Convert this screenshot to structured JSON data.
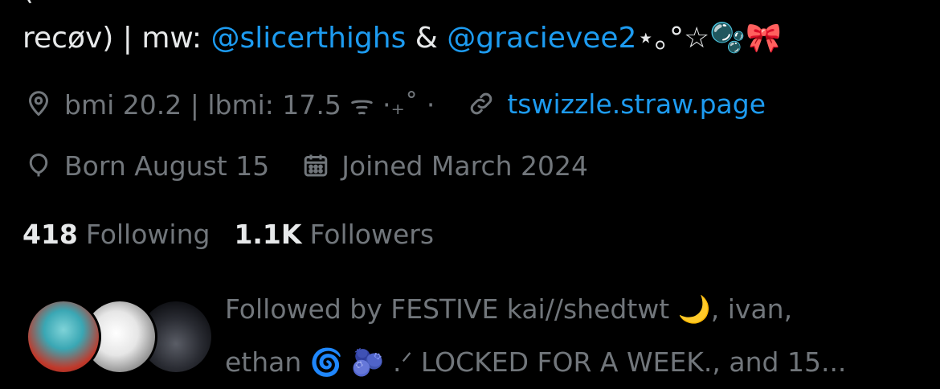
{
  "bio": {
    "top_partial": "                                                                                       (",
    "line_prefix": "recøv) | mw: ",
    "mention1": "@slicerthighs",
    "amp": " & ",
    "mention2": "@gracievee2",
    "line_suffix": "⋆｡°☆🫧🎀"
  },
  "meta": {
    "location": "bmi 20.2 | lbmi: 17.5 ᯤ ·₊˚ ·",
    "website": "tswizzle.straw.page",
    "birthday": "Born August 15",
    "joined": "Joined March 2024"
  },
  "stats": {
    "following_count": "418",
    "following_label": "Following",
    "followers_count": "1.1K",
    "followers_label": "Followers"
  },
  "followed_by": {
    "line1": "Followed by FESTIVE kai//shedtwt 🌙, ivan,",
    "line2": "ethan 🌀 🫐 .ᐟ LOCKED FOR A WEEK., and 15..."
  },
  "icons": {
    "location": "location-pin-icon",
    "link": "link-icon",
    "birthday": "balloon-icon",
    "calendar": "calendar-icon"
  },
  "colors": {
    "background": "#000000",
    "text": "#e7e9ea",
    "muted": "#71767b",
    "accent": "#1d9bf0"
  }
}
